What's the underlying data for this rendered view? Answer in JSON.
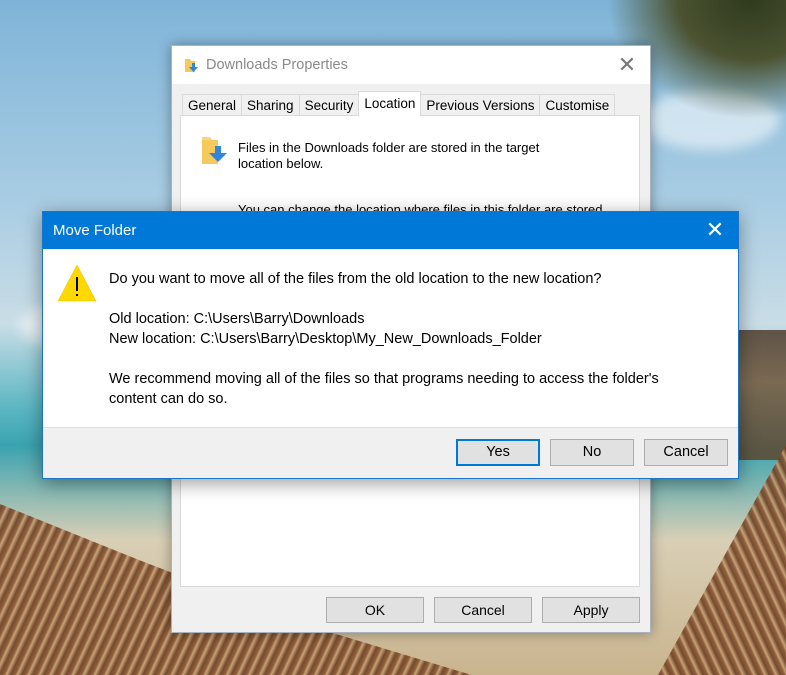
{
  "properties_window": {
    "title": "Downloads Properties",
    "close_icon": "close-icon",
    "tabs": [
      {
        "label": "General",
        "active": false
      },
      {
        "label": "Sharing",
        "active": false
      },
      {
        "label": "Security",
        "active": false
      },
      {
        "label": "Location",
        "active": true
      },
      {
        "label": "Previous Versions",
        "active": false
      },
      {
        "label": "Customise",
        "active": false
      }
    ],
    "location_panel": {
      "description": "Files in the Downloads folder are stored in the target location below.",
      "change_text": "You can change the location where files in this folder are stored"
    },
    "buttons": {
      "ok": "OK",
      "cancel": "Cancel",
      "apply": "Apply"
    }
  },
  "move_folder_dialog": {
    "title": "Move Folder",
    "icon": "warning-icon",
    "question": "Do you want to move all of the files from the old location to the new location?",
    "old_location_label": "Old location: C:\\Users\\Barry\\Downloads",
    "new_location_label": "New location: C:\\Users\\Barry\\Desktop\\My_New_Downloads_Folder",
    "recommendation": "We recommend moving all of the files so that programs needing to access the folder's content can do so.",
    "buttons": {
      "yes": "Yes",
      "no": "No",
      "cancel": "Cancel"
    },
    "accent_color": "#0078d7"
  }
}
